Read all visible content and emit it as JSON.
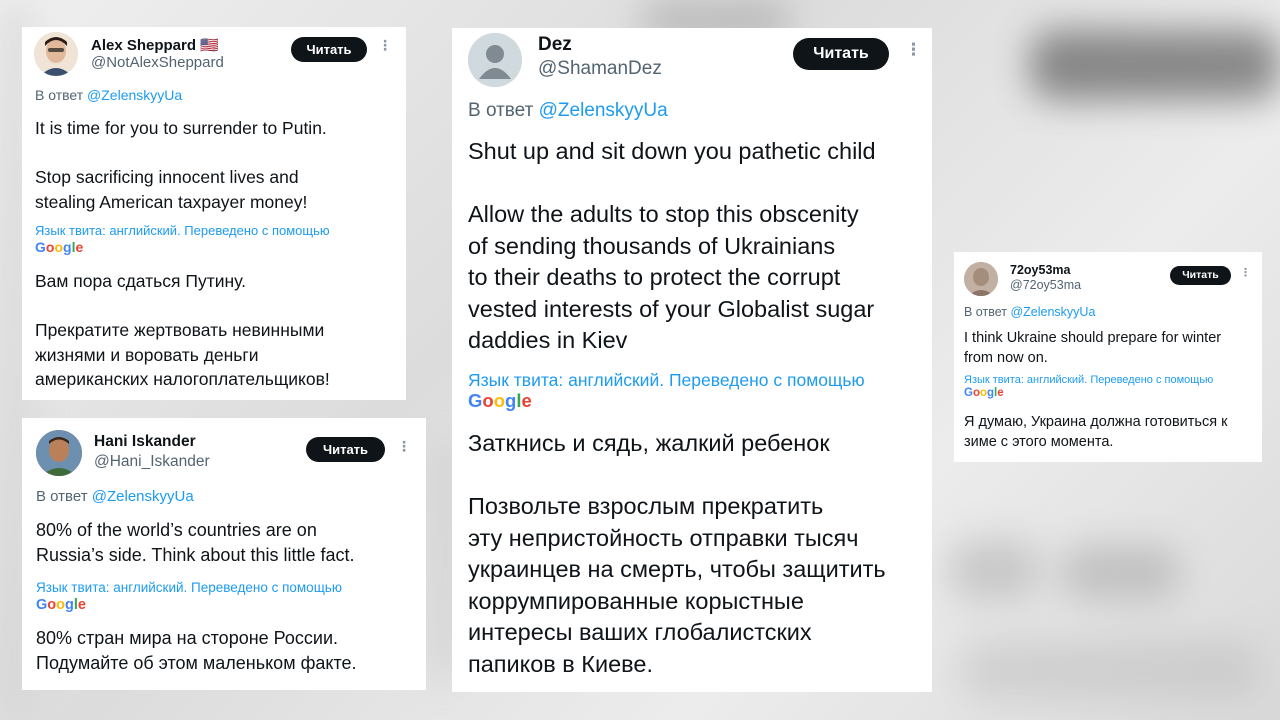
{
  "tweets": [
    {
      "name": "Alex Sheppard",
      "flag": "🇺🇸",
      "handle": "@NotAlexSheppard",
      "follow_label": "Читать",
      "reply_prefix": "В ответ",
      "reply_to": "@ZelenskyyUa",
      "text": "It is time for you to surrender to Putin.\n\nStop sacrificing innocent lives and\nstealing American taxpayer money!",
      "translation_note": "Язык твита: английский. Переведено с помощью",
      "translated_text": "Вам пора сдаться Путину.\n\nПрекратите жертвовать невинными\nжизнями и воровать деньги\nамериканских налогоплательщиков!"
    },
    {
      "name": "Hani Iskander",
      "handle": "@Hani_Iskander",
      "follow_label": "Читать",
      "reply_prefix": "В ответ",
      "reply_to": "@ZelenskyyUa",
      "text": "80% of the world’s countries are on\nRussia’s side. Think about this little fact.",
      "translation_note": "Язык твита: английский. Переведено с помощью",
      "translated_text": "80% стран мира на стороне России.\nПодумайте об этом маленьком факте."
    },
    {
      "name": "Dez",
      "handle": "@ShamanDez",
      "follow_label": "Читать",
      "reply_prefix": "В ответ",
      "reply_to": "@ZelenskyyUa",
      "text": "Shut up and sit down you pathetic child\n\nAllow the adults to stop this obscenity\nof sending thousands of Ukrainians\nto their deaths to protect the corrupt\nvested interests of your Globalist sugar\ndaddies in Kiev",
      "translation_note": "Язык твита: английский. Переведено с помощью",
      "translated_text": "Заткнись и сядь, жалкий ребенок\n\nПозвольте взрослым прекратить\nэту непристойность отправки тысяч\nукраинцев на смерть, чтобы защитить\nкоррумпированные корыстные\nинтересы ваших глобалистских\nпапиков в Киеве."
    },
    {
      "name": "72oy53ma",
      "handle": "@72oy53ma",
      "follow_label": "Читать",
      "reply_prefix": "В ответ",
      "reply_to": "@ZelenskyyUa",
      "text": "I think Ukraine should prepare for winter\nfrom now on.",
      "translation_note": "Язык твита: английский. Переведено с помощью",
      "translated_text": "Я думаю, Украина должна готовиться к\nзиме с этого момента."
    }
  ],
  "google_logo": [
    "G",
    "o",
    "o",
    "g",
    "l",
    "e"
  ],
  "more_glyph": "⋮",
  "colors": {
    "link_blue": "#1d9bf0",
    "button_black": "#0f1419",
    "secondary_gray": "#536471"
  }
}
